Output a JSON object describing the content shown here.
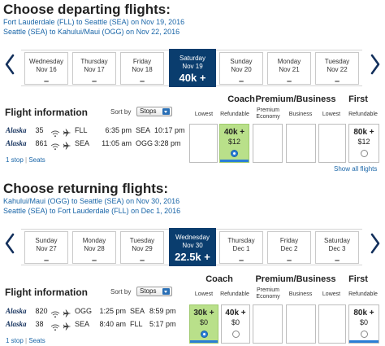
{
  "departing": {
    "title": "Choose departing flights:",
    "routes": [
      "Fort Lauderdale (FLL) to Seattle (SEA) on Nov 19, 2016",
      "Seattle (SEA) to Kahului/Maui (OGG) on Nov 22, 2016"
    ],
    "dates": [
      {
        "dow": "Wednesday",
        "date": "Nov 16",
        "price": "–"
      },
      {
        "dow": "Thursday",
        "date": "Nov 17",
        "price": "–"
      },
      {
        "dow": "Friday",
        "date": "Nov 18",
        "price": "–"
      },
      {
        "dow": "Saturday",
        "date": "Nov 19",
        "price": "40k +"
      },
      {
        "dow": "Sunday",
        "date": "Nov 20",
        "price": "–"
      },
      {
        "dow": "Monday",
        "date": "Nov 21",
        "price": "–"
      },
      {
        "dow": "Tuesday",
        "date": "Nov 22",
        "price": "–"
      }
    ],
    "flight_info_label": "Flight information",
    "sort_label": "Sort by",
    "sort_value": "Stops",
    "categories": {
      "coach": "Coach",
      "premium": "Premium/Business",
      "first": "First"
    },
    "subheads": {
      "lowest": "Lowest",
      "refundable": "Refundable",
      "premium_economy": "Premium Economy",
      "business": "Business"
    },
    "flights": [
      {
        "airline": "Alaska",
        "number": "35",
        "from": "FLL",
        "dep": "6:35 pm",
        "to": "SEA",
        "arr": "10:17 pm"
      },
      {
        "airline": "Alaska",
        "number": "861",
        "from": "SEA",
        "dep": "11:05 am",
        "to": "OGG",
        "arr": "3:28 pm"
      }
    ],
    "stops": "1 stop",
    "seats": "Seats",
    "fares": {
      "coach_refundable": {
        "miles": "40k +",
        "tax": "$12"
      },
      "first_refundable": {
        "miles": "80k +",
        "tax": "$12"
      }
    },
    "show_all": "Show all flights"
  },
  "returning": {
    "title": "Choose returning flights:",
    "routes": [
      "Kahului/Maui (OGG) to Seattle (SEA) on Nov 30, 2016",
      "Seattle (SEA) to Fort Lauderdale (FLL) on Dec 1, 2016"
    ],
    "dates": [
      {
        "dow": "Sunday",
        "date": "Nov 27",
        "price": "–"
      },
      {
        "dow": "Monday",
        "date": "Nov 28",
        "price": "–"
      },
      {
        "dow": "Tuesday",
        "date": "Nov 29",
        "price": "–"
      },
      {
        "dow": "Wednesday",
        "date": "Nov 30",
        "price": "22.5k +"
      },
      {
        "dow": "Thursday",
        "date": "Dec 1",
        "price": "–"
      },
      {
        "dow": "Friday",
        "date": "Dec 2",
        "price": "–"
      },
      {
        "dow": "Saturday",
        "date": "Dec 3",
        "price": "–"
      }
    ],
    "flight_info_label": "Flight information",
    "sort_label": "Sort by",
    "sort_value": "Stops",
    "categories": {
      "coach": "Coach",
      "premium": "Premium/Business",
      "first": "First"
    },
    "subheads": {
      "lowest": "Lowest",
      "refundable": "Refundable",
      "premium_economy": "Premium Economy",
      "business": "Business"
    },
    "flights": [
      {
        "airline": "Alaska",
        "number": "820",
        "from": "OGG",
        "dep": "1:25 pm",
        "to": "SEA",
        "arr": "8:59 pm"
      },
      {
        "airline": "Alaska",
        "number": "38",
        "from": "SEA",
        "dep": "8:40 am",
        "to": "FLL",
        "arr": "5:17 pm"
      }
    ],
    "stops": "1 stop",
    "seats": "Seats",
    "fares": {
      "coach_lowest": {
        "miles": "30k +",
        "tax": "$0"
      },
      "coach_refundable": {
        "miles": "40k +",
        "tax": "$0"
      },
      "first_refundable": {
        "miles": "80k +",
        "tax": "$0"
      }
    }
  },
  "colors": {
    "selected_date": "#0a3d6e",
    "highlight_fare": "#b9e08a",
    "link": "#1a66a8",
    "radio_selected": "#2a7ed6"
  }
}
